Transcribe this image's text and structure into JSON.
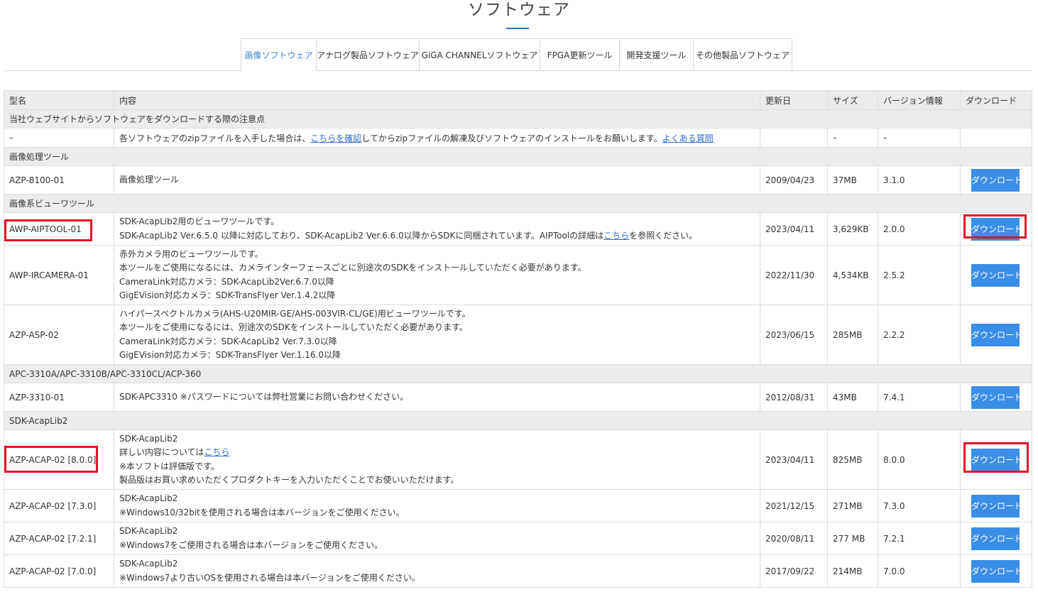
{
  "page": {
    "title": "ソフトウェア"
  },
  "tabs": [
    {
      "label": "画像ソフトウェア",
      "active": true
    },
    {
      "label": "アナログ製品ソフトウェア"
    },
    {
      "label": "GiGA CHANNELソフトウェア"
    },
    {
      "label": "FPGA更新ツール"
    },
    {
      "label": "開発支援ツール"
    },
    {
      "label": "その他製品ソフトウェア"
    }
  ],
  "table": {
    "headers": {
      "model": "型名",
      "content": "内容",
      "updated": "更新日",
      "size": "サイズ",
      "version": "バージョン情報",
      "download": "ダウンロード"
    },
    "notice": {
      "section": "当社ウェブサイトからソフトウェアをダウンロードする際の注意点",
      "model": "–",
      "text_before": "各ソフトウェアのzipファイルを入手した場合は、",
      "link1": "こちらを確認",
      "text_after": "してからzipファイルの解凍及びソフトウェアのインストールをお願いします。",
      "link2": "よくある質問",
      "size": "–",
      "version": "–"
    },
    "sections": {
      "s1": "画像処理ツール",
      "s2": "画像系ビューワツール",
      "s3": "APC-3310A/APC-3310B/APC-3310CL/ACP-360",
      "s4": "SDK-AcapLib2"
    },
    "rows": [
      {
        "model": "AZP-8100-01",
        "desc": [
          "画像処理ツール"
        ],
        "date": "2009/04/23",
        "size": "37MB",
        "version": "3.1.0"
      },
      {
        "model": "AWP-AIPTOOL-01",
        "desc": [
          "SDK-AcapLib2用のビューワツールです。"
        ],
        "desc2_before": "SDK-AcapLib2 Ver.6.5.0 以降に対応しており、SDK-AcapLib2 Ver.6.6.0以降からSDKに同梱されています。AIPToolの詳細は",
        "desc2_link": "こちら",
        "desc2_after": "を参照ください。",
        "date": "2023/04/11",
        "size": "3,629KB",
        "version": "2.0.0"
      },
      {
        "model": "AWP-IRCAMERA-01",
        "desc": [
          "赤外カメラ用のビューワツールです。",
          "本ツールをご使用になるには、カメラインターフェースごとに別途次のSDKをインストールしていただく必要があります。",
          "CameraLink対応カメラ：SDK-AcapLib2Ver.6.7.0以降",
          "GigEVision対応カメラ：SDK-TransFlyer Ver.1.4.2以降"
        ],
        "date": "2022/11/30",
        "size": "4,534KB",
        "version": "2.5.2"
      },
      {
        "model": "AZP-ASP-02",
        "desc": [
          "ハイパースペクトルカメラ(AHS-U20MIR-GE/AHS-003VIR-CL/GE)用ビューワツールです。",
          "本ツールをご使用になるには、別途次のSDKをインストールしていただく必要があります。",
          "CameraLink対応カメラ：SDK-AcapLib2 Ver.7.3.0以降",
          "GigEVision対応カメラ：SDK-TransFlyer Ver.1.16.0以降"
        ],
        "date": "2023/06/15",
        "size": "285MB",
        "version": "2.2.2"
      },
      {
        "model": "AZP-3310-01",
        "desc": [
          "SDK-APC3310 ※パスワードについては弊社営業にお問い合わせください。"
        ],
        "date": "2012/08/31",
        "size": "43MB",
        "version": "7.4.1"
      },
      {
        "model": "AZP-ACAP-02 [8.0.0]",
        "desc": [
          "SDK-AcapLib2"
        ],
        "desc_link_before": "詳しい内容については",
        "desc_link": "こちら",
        "desc3": [
          "※本ソフトは評価版です。",
          "製品版はお買い求めいただくプロダクトキーを入力いただくことでお使いいただけます。"
        ],
        "date": "2023/04/11",
        "size": "825MB",
        "version": "8.0.0"
      },
      {
        "model": "AZP-ACAP-02 [7.3.0]",
        "desc": [
          "SDK-AcapLib2",
          "※Windows10/32bitを使用される場合は本バージョンをご使用ください。"
        ],
        "date": "2021/12/15",
        "size": "271MB",
        "version": "7.3.0"
      },
      {
        "model": "AZP-ACAP-02 [7.2.1]",
        "desc": [
          "SDK-AcapLib2",
          "※Windows7をご使用される場合は本バージョンをご使用ください。"
        ],
        "date": "2020/08/11",
        "size": "277 MB",
        "version": "7.2.1"
      },
      {
        "model": "AZP-ACAP-02 [7.0.0]",
        "desc": [
          "SDK-AcapLib2",
          "※Windows7より古いOSを使用される場合は本バージョンをご使用ください。"
        ],
        "date": "2017/09/22",
        "size": "214MB",
        "version": "7.0.0"
      }
    ],
    "download_label": "ダウンロード"
  },
  "colors": {
    "accent": "#3a8ee6",
    "highlight": "#e8102a",
    "warning": "#e8001c",
    "link": "#2a6cd1",
    "section_bg": "#ececec"
  }
}
